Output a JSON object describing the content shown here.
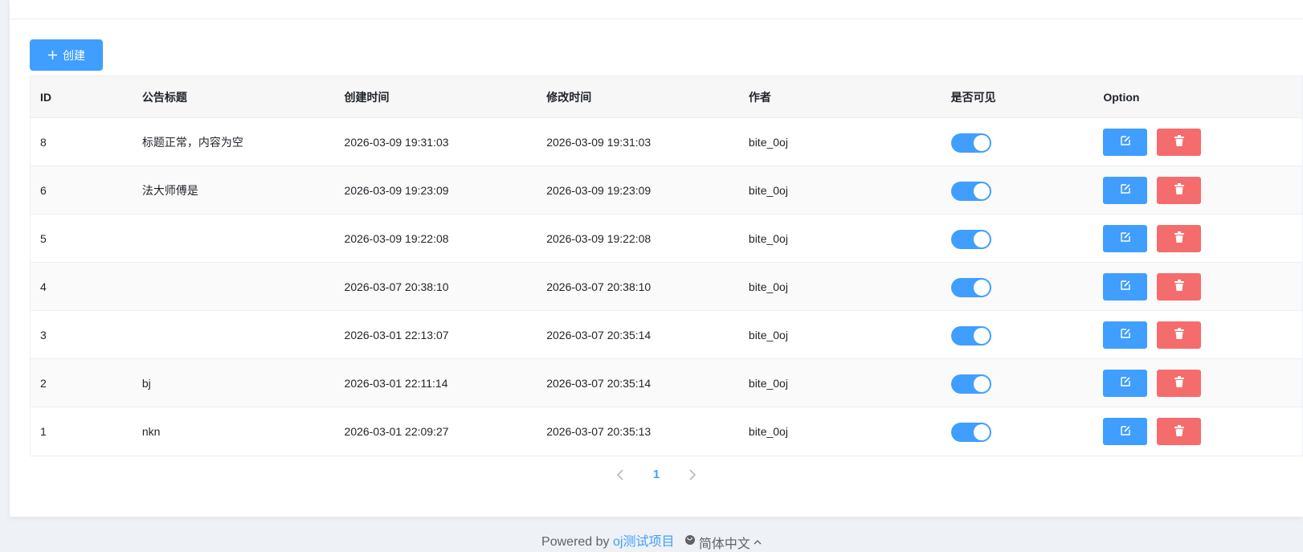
{
  "toolbar": {
    "create_label": "创建",
    "create_icon": "plus-icon"
  },
  "table": {
    "columns": {
      "id": "ID",
      "title": "公告标题",
      "created": "创建时间",
      "modified": "修改时间",
      "author": "作者",
      "visible": "是否可见",
      "option": "Option"
    },
    "rows": [
      {
        "id": "8",
        "title": "标题正常，内容为空",
        "created": "2026-03-09 19:31:03",
        "modified": "2026-03-09 19:31:03",
        "author": "bite_0oj",
        "visible": true
      },
      {
        "id": "6",
        "title": "法大师傅是",
        "created": "2026-03-09 19:23:09",
        "modified": "2026-03-09 19:23:09",
        "author": "bite_0oj",
        "visible": true
      },
      {
        "id": "5",
        "title": "",
        "created": "2026-03-09 19:22:08",
        "modified": "2026-03-09 19:22:08",
        "author": "bite_0oj",
        "visible": true
      },
      {
        "id": "4",
        "title": "",
        "created": "2026-03-07 20:38:10",
        "modified": "2026-03-07 20:38:10",
        "author": "bite_0oj",
        "visible": true
      },
      {
        "id": "3",
        "title": "",
        "created": "2026-03-01 22:13:07",
        "modified": "2026-03-07 20:35:14",
        "author": "bite_0oj",
        "visible": true
      },
      {
        "id": "2",
        "title": "bj",
        "created": "2026-03-01 22:11:14",
        "modified": "2026-03-07 20:35:14",
        "author": "bite_0oj",
        "visible": true
      },
      {
        "id": "1",
        "title": "nkn",
        "created": "2026-03-01 22:09:27",
        "modified": "2026-03-07 20:35:13",
        "author": "bite_0oj",
        "visible": true
      }
    ]
  },
  "pagination": {
    "current_page": "1"
  },
  "footer": {
    "powered_by": "Powered by",
    "project_link": "oj测试项目",
    "language": "简体中文"
  },
  "colors": {
    "primary": "#409eff",
    "danger": "#f56c6c"
  }
}
